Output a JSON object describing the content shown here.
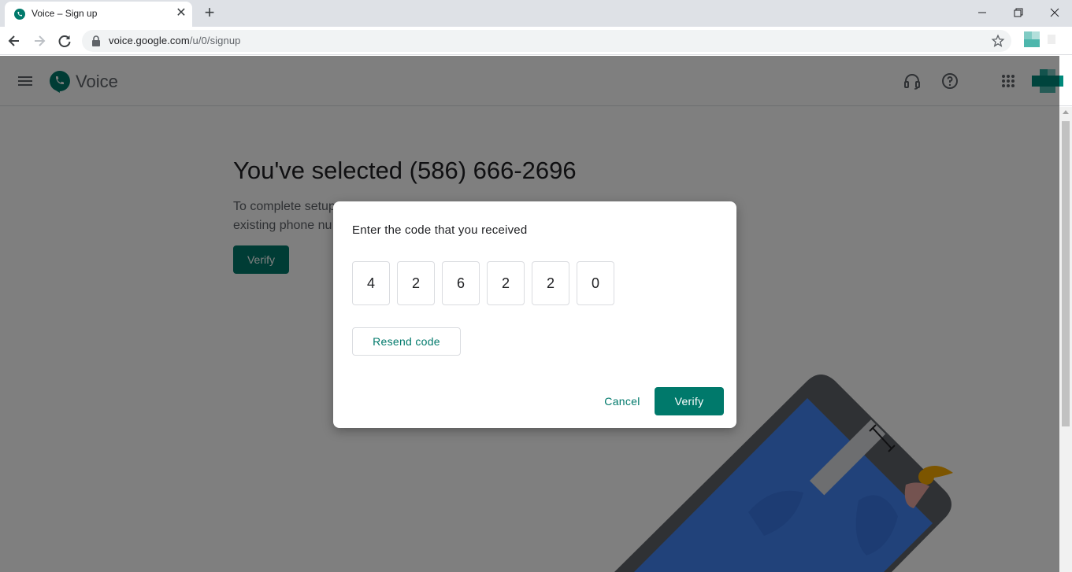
{
  "browser": {
    "tab_title": "Voice – Sign up",
    "tab_close": "✕",
    "new_tab": "+",
    "url_host": "voice.google.com",
    "url_path": "/u/0/signup"
  },
  "appbar": {
    "app_name": "Voice"
  },
  "page": {
    "heading": "You've selected (586) 666-2696",
    "sub_line1": "To complete setup",
    "sub_line2": "existing phone nu",
    "verify_label": "Verify"
  },
  "dialog": {
    "title": "Enter the code that you received",
    "code_digits": [
      "4",
      "2",
      "6",
      "2",
      "2",
      "0"
    ],
    "resend_label": "Resend code",
    "cancel_label": "Cancel",
    "verify_label": "Verify"
  },
  "colors": {
    "accent": "#00796b",
    "scrim": "rgba(0,0,0,0.5)"
  },
  "icons": [
    "phone-favicon-icon",
    "back-icon",
    "forward-icon",
    "reload-icon",
    "lock-icon",
    "star-icon",
    "menu-icon",
    "voice-logo-icon",
    "headset-icon",
    "help-icon",
    "apps-icon"
  ]
}
